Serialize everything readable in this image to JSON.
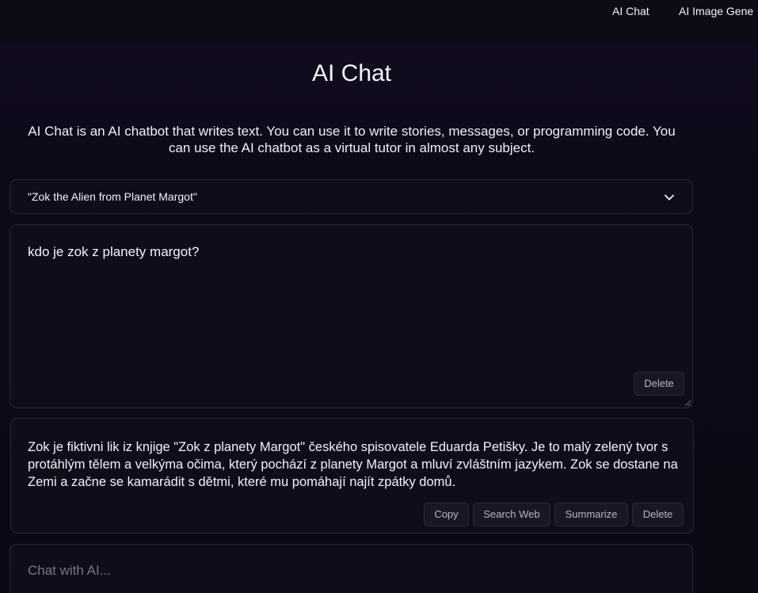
{
  "nav": {
    "links": [
      {
        "label": "AI Chat"
      },
      {
        "label": "AI Image Gene"
      }
    ]
  },
  "page": {
    "title": "AI Chat",
    "intro": "AI Chat is an AI chatbot that writes text. You can use it to write stories, messages, or programming code. You can use the AI chatbot as a virtual tutor in almost any subject."
  },
  "persona_select": {
    "selected": "\"Zok the Alien from Planet Margot\"",
    "icon": "chevron-down-icon"
  },
  "prompt": {
    "text": "kdo je zok z planety margot?",
    "delete_label": "Delete"
  },
  "response": {
    "text": "Zok je fiktivni lik iz knjige \"Zok z planety Margot\" českého spisovatele Eduarda Petišky. Je to malý zelený tvor s protáhlým tělem a velkýma očima, který pochází z planety Margot a mluví zvláštním jazykem. Zok se dostane na Zemi a začne se kamarádit s dětmi, které mu pomáhají najít zpátky domů.",
    "actions": {
      "copy": "Copy",
      "search_web": "Search Web",
      "summarize": "Summarize",
      "delete": "Delete"
    }
  },
  "chat_input": {
    "placeholder": "Chat with AI...",
    "value": ""
  },
  "colors": {
    "background": "#0a0913",
    "card": "#100d1a",
    "border": "#2a2537",
    "button": "#1a1725",
    "text": "#f3f1f7",
    "muted": "#7b7588"
  }
}
